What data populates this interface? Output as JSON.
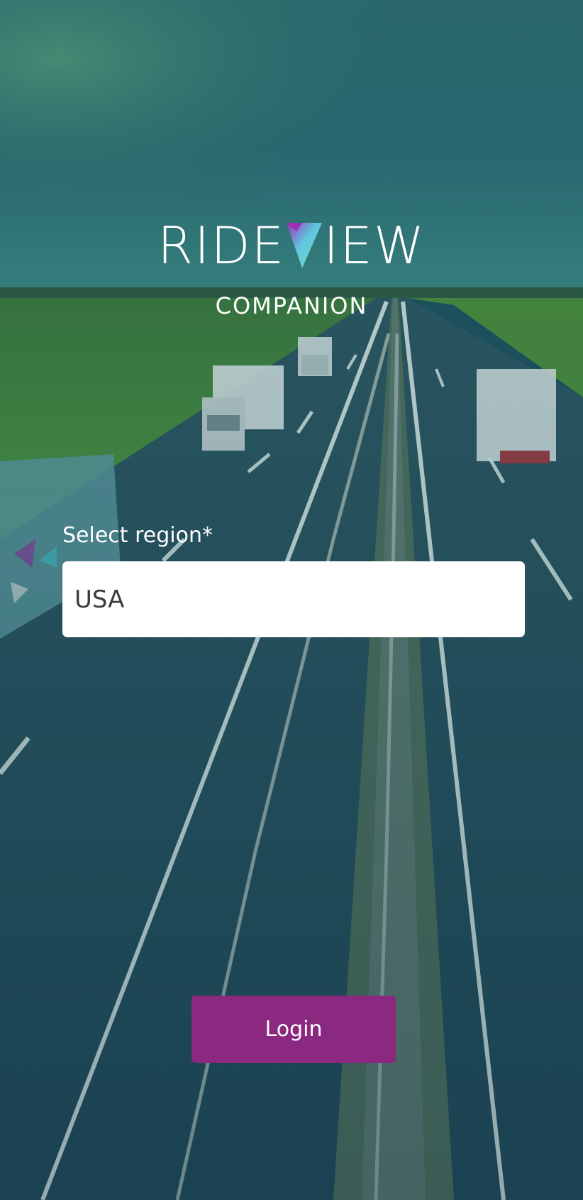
{
  "app": {
    "logo_left": "RIDE",
    "logo_right": "IEW",
    "logo_subtitle": "COMPANION"
  },
  "form": {
    "region_label": "Select region*",
    "region_value": "USA"
  },
  "actions": {
    "login_label": "Login"
  },
  "colors": {
    "button": "#8b2880",
    "overlay_top": "#2a6a6a",
    "overlay_bottom": "#1c4a5c",
    "logo_v_purple": "#9b2fb6",
    "logo_v_teal": "#5fd6d6"
  }
}
